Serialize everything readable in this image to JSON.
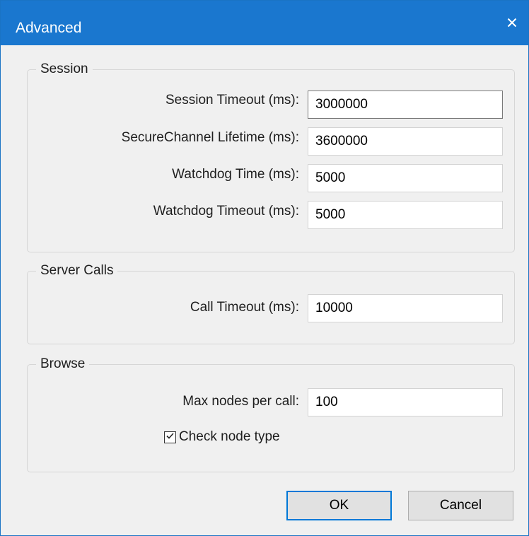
{
  "window": {
    "title": "Advanced",
    "close_glyph": "✕"
  },
  "session": {
    "legend": "Session",
    "session_timeout_label": "Session Timeout (ms):",
    "session_timeout_value": "3000000",
    "secure_channel_label": "SecureChannel Lifetime (ms):",
    "secure_channel_value": "3600000",
    "watchdog_time_label": "Watchdog Time (ms):",
    "watchdog_time_value": "5000",
    "watchdog_timeout_label": "Watchdog Timeout (ms):",
    "watchdog_timeout_value": "5000"
  },
  "server_calls": {
    "legend": "Server Calls",
    "call_timeout_label": "Call Timeout (ms):",
    "call_timeout_value": "10000"
  },
  "browse": {
    "legend": "Browse",
    "max_nodes_label": "Max nodes per call:",
    "max_nodes_value": "100",
    "check_node_type_label": "Check node type",
    "check_node_type_checked": true
  },
  "buttons": {
    "ok": "OK",
    "cancel": "Cancel"
  },
  "icons": {
    "close": "close-icon",
    "check": "checkmark-icon"
  },
  "colors": {
    "titlebar": "#1a77cf",
    "default_button_border": "#0078d7"
  }
}
